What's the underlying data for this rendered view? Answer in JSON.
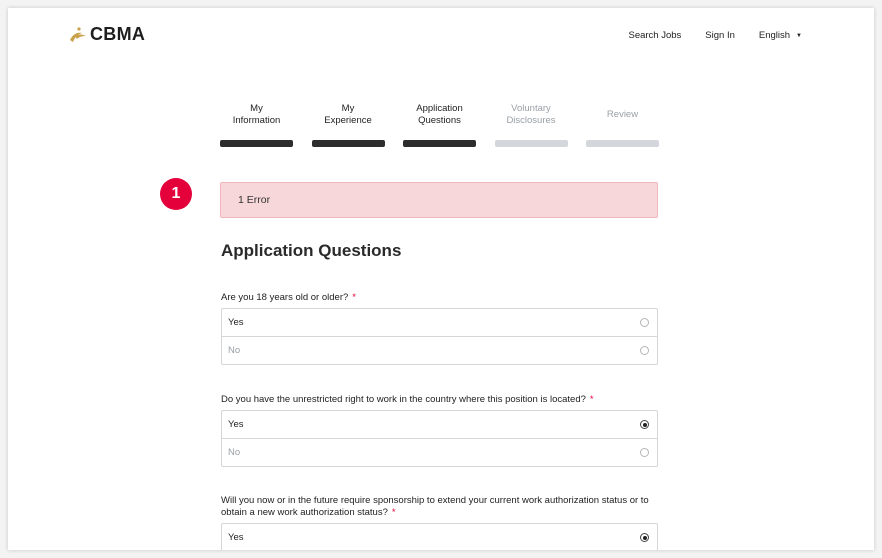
{
  "brand": {
    "name": "CBMA",
    "swoosh_color": "#c9a24b"
  },
  "nav": {
    "search_jobs": "Search Jobs",
    "sign_in": "Sign In",
    "language": "English",
    "caret": "▼"
  },
  "steps": [
    {
      "label": "My\nInformation",
      "state": "complete"
    },
    {
      "label": "My\nExperience",
      "state": "complete"
    },
    {
      "label": "Application\nQuestions",
      "state": "current"
    },
    {
      "label": "Voluntary\nDisclosures",
      "state": "upcoming"
    },
    {
      "label": "Review",
      "state": "upcoming"
    }
  ],
  "errors": {
    "count_badge": "1",
    "message": "1 Error",
    "color": "#e4003a",
    "box_bg": "#f8d7da"
  },
  "page_title": "Application Questions",
  "required_marker": "*",
  "questions": [
    {
      "label": "Are you 18 years old or older?",
      "options": [
        {
          "label": "Yes",
          "selected": false
        },
        {
          "label": "No",
          "selected": false
        }
      ]
    },
    {
      "label": "Do you have the unrestricted right to work in the country where this position is located?",
      "options": [
        {
          "label": "Yes",
          "selected": true
        },
        {
          "label": "No",
          "selected": false
        }
      ]
    },
    {
      "label": "Will you now or in the future require sponsorship to extend your current work authorization status or to obtain a new work authorization status?",
      "options": [
        {
          "label": "Yes",
          "selected": true
        }
      ]
    }
  ]
}
